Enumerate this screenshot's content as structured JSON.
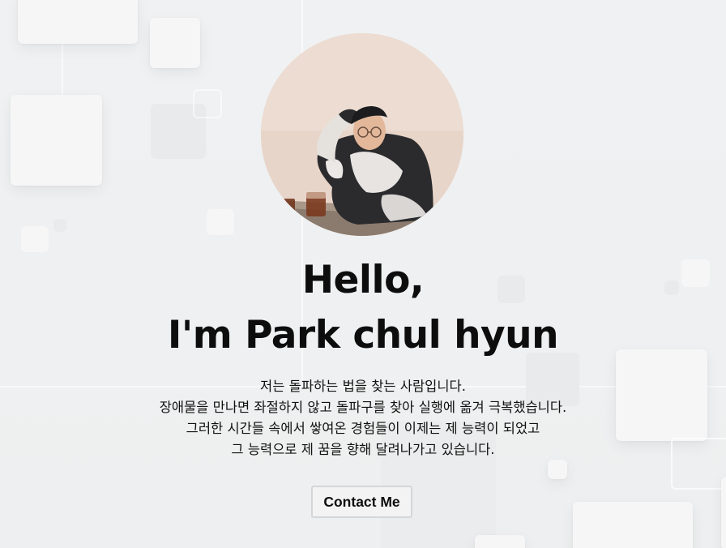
{
  "hero": {
    "greeting_line1": "Hello,",
    "greeting_line2": "I'm Park chul hyun",
    "intro_lines": [
      "저는 돌파하는 법을 찾는 사람입니다.",
      "장애물을 만나면 좌절하지 않고 돌파구를 찾아 실행에 옮겨 극복했습니다.",
      "그러한 시간들 속에서 쌓여온 경험들이 이제는 제 능력이 되었고",
      "그 능력으로 제 꿈을 향해 달려나가고 있습니다."
    ],
    "cta_label": "Contact Me"
  }
}
